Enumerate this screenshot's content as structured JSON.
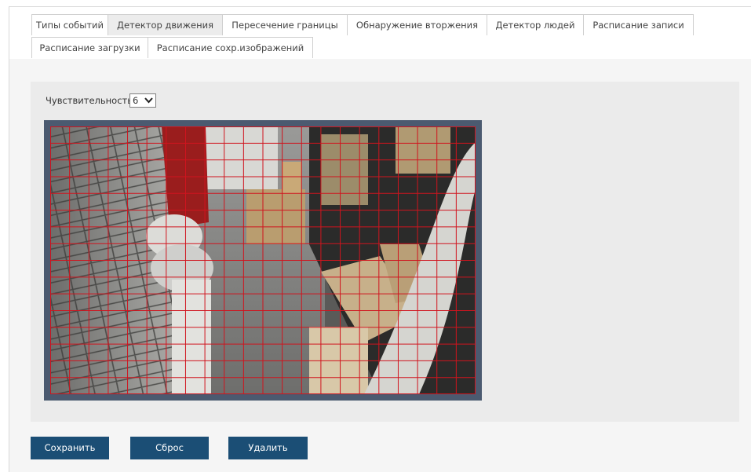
{
  "tabs_row1": [
    {
      "label": "Типы событий",
      "active": false
    },
    {
      "label": "Детектор движения",
      "active": true
    },
    {
      "label": "Пересечение границы",
      "active": false
    },
    {
      "label": "Обнаружение вторжения",
      "active": false
    },
    {
      "label": "Детектор людей",
      "active": false
    },
    {
      "label": "Расписание записи",
      "active": false
    }
  ],
  "tabs_row2": [
    {
      "label": "Расписание загрузки",
      "active": false
    },
    {
      "label": "Расписание сохр.изображений",
      "active": false
    }
  ],
  "sensitivity": {
    "label": "Чувствительность",
    "value": "6"
  },
  "motion_grid": {
    "columns": 22,
    "rows": 16,
    "line_color": "#d0141e"
  },
  "buttons": {
    "save": "Сохранить",
    "reset": "Сброс",
    "delete": "Удалить"
  },
  "colors": {
    "button": "#1b4e75",
    "video_border": "#4b5a70",
    "panel": "#ebebeb"
  }
}
